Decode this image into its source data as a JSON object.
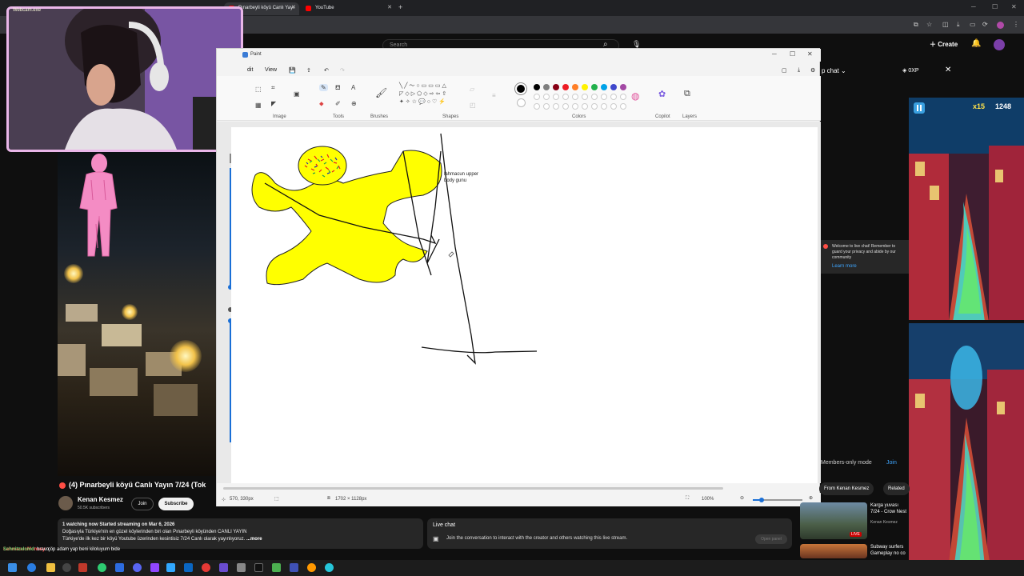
{
  "browser": {
    "tabs": [
      {
        "label": "Pınarbeyli köyü Canlı Yayı"
      },
      {
        "label": "YouTube"
      }
    ],
    "new_tab": "+"
  },
  "youtube": {
    "search_placeholder": "Search",
    "create_label": "Create",
    "chat_header": "p chat",
    "xp_label": "0XP",
    "chat_welcome_text": "Welcome to live chat! Remember to guard your privacy and abide by our community",
    "chat_learn_more": "Learn more",
    "members_only": "Members-only mode",
    "members_join": "Join",
    "chips": [
      "From Kenan Kesmez",
      "Related"
    ],
    "recommendations": [
      {
        "title": "Karga yuvası 7/24 - Crow Nest",
        "channel": "Kenan Kesmez",
        "badge": "LIVE"
      },
      {
        "title": "Subway surfers Gameplay no co"
      }
    ]
  },
  "webcam": {
    "label": "Webcam.exe"
  },
  "paint": {
    "title": "Paint",
    "menu": [
      "dit",
      "View"
    ],
    "groups": [
      "Image",
      "Tools",
      "Brushes",
      "Shapes",
      "Colors",
      "Copilot",
      "Layers"
    ],
    "colors_row1": [
      "#000000",
      "#7f7f7f",
      "#880015",
      "#ed1c24",
      "#ff7f27",
      "#fff200",
      "#22b14c",
      "#00a2e8",
      "#3f48cc",
      "#a349a4"
    ],
    "colors_row2": [
      "#ffffff",
      "#c3c3c3",
      "#b97a57",
      "#ffaec9",
      "#ffc90e",
      "#efe4b0",
      "#b5e61d",
      "#99d9ea",
      "#7092be",
      "#c8bfe7"
    ],
    "canvas_text": [
      "lahmacun upper",
      "body gunu"
    ],
    "status_cursor": "570, 330px",
    "status_size": "1702 × 1128px",
    "zoom": "100%"
  },
  "video": {
    "title": "(4) Pınarbeyli köyü Canlı Yayın 7/24 (Tok",
    "channel": "Kenan Kesmez",
    "subscribers": "50.5K subscribers",
    "join": "Join",
    "subscribe": "Subscribe",
    "desc_line1": "1 watching now  Started streaming on Mar 6, 2026",
    "desc_line2": "Doğasıyla Türkiye'nin en güzel köylerinden biri olan Pınarbeyli köyünden CANLI YAYIN",
    "desc_line3": "Türkiye'de ilk kez bir köyü Youtube üzerinden kesintisiz 7/24 Canlı olarak yayınlıyoruz.",
    "desc_more": "...more"
  },
  "livechat": {
    "title": "Live chat",
    "text": "Join the conversation to interact with the creator and others watching this live stream.",
    "button": "Open panel"
  },
  "stream_chat": [
    {
      "user": "LahmacunMonsey",
      "msg": "çöp adam yap beni kiloluyum bide"
    },
    {
      "user": "Schnitzelcmd",
      "msg": "bravo"
    }
  ]
}
